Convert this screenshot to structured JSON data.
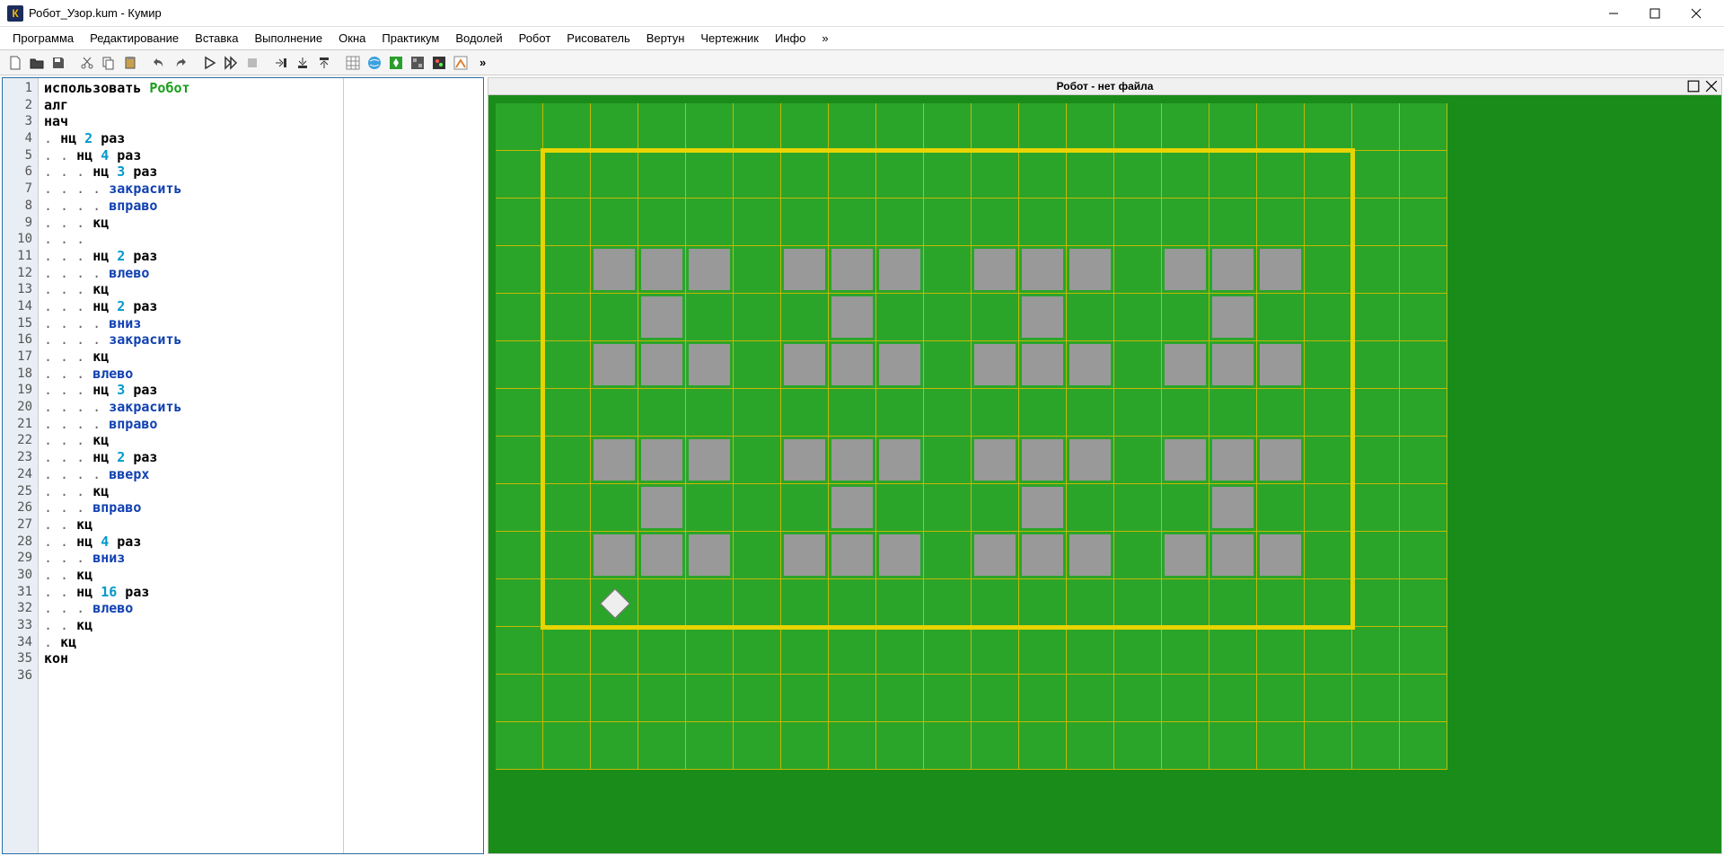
{
  "window": {
    "title": "Робот_Узор.kum - Кумир",
    "icon_letter": "К"
  },
  "menu": {
    "items": [
      "Программа",
      "Редактирование",
      "Вставка",
      "Выполнение",
      "Окна",
      "Практикум",
      "Водолей",
      "Робот",
      "Рисователь",
      "Вертун",
      "Чертежник",
      "Инфо"
    ],
    "overflow": "»"
  },
  "toolbar": {
    "overflow": "»"
  },
  "robot_panel": {
    "title": "Робот - нет файла"
  },
  "code_lines": [
    {
      "n": 1,
      "segs": [
        {
          "t": "использовать ",
          "c": "kw"
        },
        {
          "t": "Робот",
          "c": "grn"
        }
      ]
    },
    {
      "n": 2,
      "segs": [
        {
          "t": "алг",
          "c": "kw"
        }
      ]
    },
    {
      "n": 3,
      "segs": [
        {
          "t": "нач",
          "c": "kw"
        }
      ]
    },
    {
      "n": 4,
      "segs": [
        {
          "t": ". ",
          "c": "dot"
        },
        {
          "t": "нц ",
          "c": "kw"
        },
        {
          "t": "2",
          "c": "num"
        },
        {
          "t": " раз",
          "c": "kw"
        }
      ]
    },
    {
      "n": 5,
      "segs": [
        {
          "t": ". . ",
          "c": "dot"
        },
        {
          "t": "нц ",
          "c": "kw"
        },
        {
          "t": "4",
          "c": "num"
        },
        {
          "t": " раз",
          "c": "kw"
        }
      ]
    },
    {
      "n": 6,
      "segs": [
        {
          "t": ". . . ",
          "c": "dot"
        },
        {
          "t": "нц ",
          "c": "kw"
        },
        {
          "t": "3",
          "c": "num"
        },
        {
          "t": " раз",
          "c": "kw"
        }
      ]
    },
    {
      "n": 7,
      "segs": [
        {
          "t": ". . . . ",
          "c": "dot"
        },
        {
          "t": "закрасить",
          "c": "cmd"
        }
      ]
    },
    {
      "n": 8,
      "segs": [
        {
          "t": ". . . . ",
          "c": "dot"
        },
        {
          "t": "вправо",
          "c": "cmd"
        }
      ]
    },
    {
      "n": 9,
      "segs": [
        {
          "t": ". . . ",
          "c": "dot"
        },
        {
          "t": "кц",
          "c": "kw"
        }
      ]
    },
    {
      "n": 10,
      "segs": [
        {
          "t": ". . .",
          "c": "dot"
        }
      ]
    },
    {
      "n": 11,
      "segs": [
        {
          "t": ". . . ",
          "c": "dot"
        },
        {
          "t": "нц ",
          "c": "kw"
        },
        {
          "t": "2",
          "c": "num"
        },
        {
          "t": " раз",
          "c": "kw"
        }
      ]
    },
    {
      "n": 12,
      "segs": [
        {
          "t": ". . . . ",
          "c": "dot"
        },
        {
          "t": "влево",
          "c": "cmd"
        }
      ]
    },
    {
      "n": 13,
      "segs": [
        {
          "t": ". . . ",
          "c": "dot"
        },
        {
          "t": "кц",
          "c": "kw"
        }
      ]
    },
    {
      "n": 14,
      "segs": [
        {
          "t": ". . . ",
          "c": "dot"
        },
        {
          "t": "нц ",
          "c": "kw"
        },
        {
          "t": "2",
          "c": "num"
        },
        {
          "t": " раз",
          "c": "kw"
        }
      ]
    },
    {
      "n": 15,
      "segs": [
        {
          "t": ". . . . ",
          "c": "dot"
        },
        {
          "t": "вниз",
          "c": "cmd"
        }
      ]
    },
    {
      "n": 16,
      "segs": [
        {
          "t": ". . . . ",
          "c": "dot"
        },
        {
          "t": "закрасить",
          "c": "cmd"
        }
      ]
    },
    {
      "n": 17,
      "segs": [
        {
          "t": ". . . ",
          "c": "dot"
        },
        {
          "t": "кц",
          "c": "kw"
        }
      ]
    },
    {
      "n": 18,
      "segs": [
        {
          "t": ". . . ",
          "c": "dot"
        },
        {
          "t": "влево",
          "c": "cmd"
        }
      ]
    },
    {
      "n": 19,
      "segs": [
        {
          "t": ". . . ",
          "c": "dot"
        },
        {
          "t": "нц ",
          "c": "kw"
        },
        {
          "t": "3",
          "c": "num"
        },
        {
          "t": " раз",
          "c": "kw"
        }
      ]
    },
    {
      "n": 20,
      "segs": [
        {
          "t": ". . . . ",
          "c": "dot"
        },
        {
          "t": "закрасить",
          "c": "cmd"
        }
      ]
    },
    {
      "n": 21,
      "segs": [
        {
          "t": ". . . . ",
          "c": "dot"
        },
        {
          "t": "вправо",
          "c": "cmd"
        }
      ]
    },
    {
      "n": 22,
      "segs": [
        {
          "t": ". . . ",
          "c": "dot"
        },
        {
          "t": "кц",
          "c": "kw"
        }
      ]
    },
    {
      "n": 23,
      "segs": [
        {
          "t": ". . . ",
          "c": "dot"
        },
        {
          "t": "нц ",
          "c": "kw"
        },
        {
          "t": "2",
          "c": "num"
        },
        {
          "t": " раз",
          "c": "kw"
        }
      ]
    },
    {
      "n": 24,
      "segs": [
        {
          "t": ". . . . ",
          "c": "dot"
        },
        {
          "t": "вверх",
          "c": "cmd"
        }
      ]
    },
    {
      "n": 25,
      "segs": [
        {
          "t": ". . . ",
          "c": "dot"
        },
        {
          "t": "кц",
          "c": "kw"
        }
      ]
    },
    {
      "n": 26,
      "segs": [
        {
          "t": ". . . ",
          "c": "dot"
        },
        {
          "t": "вправо",
          "c": "cmd"
        }
      ]
    },
    {
      "n": 27,
      "segs": [
        {
          "t": ". . ",
          "c": "dot"
        },
        {
          "t": "кц",
          "c": "kw"
        }
      ]
    },
    {
      "n": 28,
      "segs": [
        {
          "t": ". . ",
          "c": "dot"
        },
        {
          "t": "нц ",
          "c": "kw"
        },
        {
          "t": "4",
          "c": "num"
        },
        {
          "t": " раз",
          "c": "kw"
        }
      ]
    },
    {
      "n": 29,
      "segs": [
        {
          "t": ". . . ",
          "c": "dot"
        },
        {
          "t": "вниз",
          "c": "cmd"
        }
      ]
    },
    {
      "n": 30,
      "segs": [
        {
          "t": ". . ",
          "c": "dot"
        },
        {
          "t": "кц",
          "c": "kw"
        }
      ]
    },
    {
      "n": 31,
      "segs": [
        {
          "t": ". . ",
          "c": "dot"
        },
        {
          "t": "нц ",
          "c": "kw"
        },
        {
          "t": "16",
          "c": "num"
        },
        {
          "t": " раз",
          "c": "kw"
        }
      ]
    },
    {
      "n": 32,
      "segs": [
        {
          "t": ". . . ",
          "c": "dot"
        },
        {
          "t": "влево",
          "c": "cmd"
        }
      ]
    },
    {
      "n": 33,
      "segs": [
        {
          "t": ". . ",
          "c": "dot"
        },
        {
          "t": "кц",
          "c": "kw"
        }
      ]
    },
    {
      "n": 34,
      "segs": [
        {
          "t": ". ",
          "c": "dot"
        },
        {
          "t": "кц",
          "c": "kw"
        }
      ]
    },
    {
      "n": 35,
      "segs": [
        {
          "t": "кон",
          "c": "kw"
        }
      ]
    },
    {
      "n": 36,
      "segs": []
    }
  ],
  "grid": {
    "cols": 20,
    "rows": 13,
    "cell_size": 53,
    "field": {
      "left": 1,
      "top": 1,
      "width": 17,
      "height": 10
    },
    "robot": {
      "col": 1,
      "row": 9
    },
    "painted": [
      [
        1,
        1
      ],
      [
        2,
        1
      ],
      [
        3,
        1
      ],
      [
        5,
        1
      ],
      [
        6,
        1
      ],
      [
        7,
        1
      ],
      [
        9,
        1
      ],
      [
        10,
        1
      ],
      [
        11,
        1
      ],
      [
        13,
        1
      ],
      [
        14,
        1
      ],
      [
        15,
        1
      ],
      [
        2,
        2
      ],
      [
        6,
        2
      ],
      [
        10,
        2
      ],
      [
        14,
        2
      ],
      [
        1,
        3
      ],
      [
        2,
        3
      ],
      [
        3,
        3
      ],
      [
        5,
        3
      ],
      [
        6,
        3
      ],
      [
        7,
        3
      ],
      [
        9,
        3
      ],
      [
        10,
        3
      ],
      [
        11,
        3
      ],
      [
        13,
        3
      ],
      [
        14,
        3
      ],
      [
        15,
        3
      ],
      [
        1,
        5
      ],
      [
        2,
        5
      ],
      [
        3,
        5
      ],
      [
        5,
        5
      ],
      [
        6,
        5
      ],
      [
        7,
        5
      ],
      [
        9,
        5
      ],
      [
        10,
        5
      ],
      [
        11,
        5
      ],
      [
        13,
        5
      ],
      [
        14,
        5
      ],
      [
        15,
        5
      ],
      [
        2,
        6
      ],
      [
        6,
        6
      ],
      [
        10,
        6
      ],
      [
        14,
        6
      ],
      [
        1,
        7
      ],
      [
        2,
        7
      ],
      [
        3,
        7
      ],
      [
        5,
        7
      ],
      [
        6,
        7
      ],
      [
        7,
        7
      ],
      [
        9,
        7
      ],
      [
        10,
        7
      ],
      [
        11,
        7
      ],
      [
        13,
        7
      ],
      [
        14,
        7
      ],
      [
        15,
        7
      ]
    ]
  }
}
